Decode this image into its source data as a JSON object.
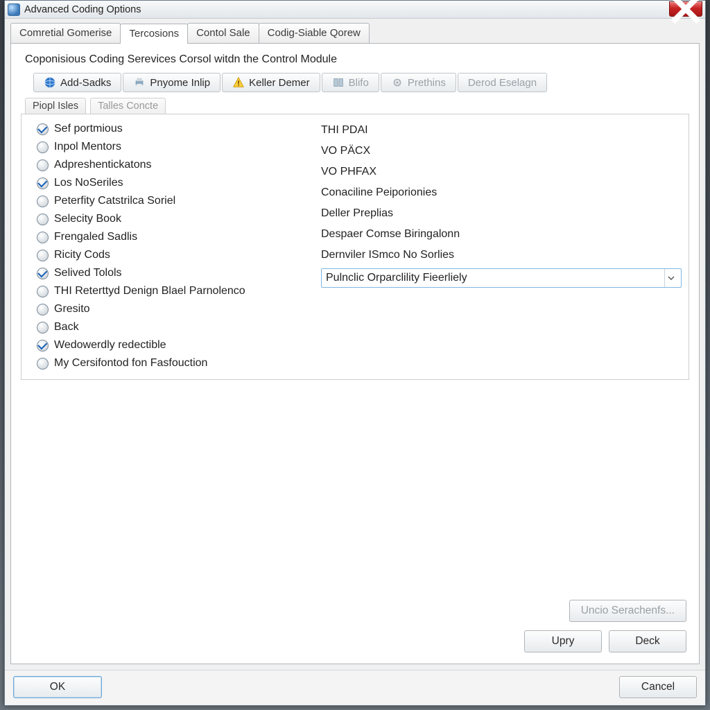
{
  "window": {
    "title": "Advanced Coding Options"
  },
  "tabs": [
    {
      "label": "Comretial Gomerise"
    },
    {
      "label": "Tercosions"
    },
    {
      "label": "Contol Sale"
    },
    {
      "label": "Codig-Siable Qorew"
    }
  ],
  "section_title": "Coponisious Coding Serevices Corsol witdn the Control Module",
  "toolbar": [
    {
      "label": "Add-Sadks",
      "icon": "globe-icon",
      "disabled": false
    },
    {
      "label": "Pnyome Inlip",
      "icon": "print-icon",
      "disabled": false
    },
    {
      "label": "Keller Demer",
      "icon": "warning-icon",
      "disabled": false
    },
    {
      "label": "Blifo",
      "icon": "book-icon",
      "disabled": true
    },
    {
      "label": "Prethins",
      "icon": "gear-icon",
      "disabled": true
    },
    {
      "label": "Derod Eselagn",
      "icon": "",
      "disabled": true
    }
  ],
  "subtabs": [
    {
      "label": "Piopl Isles"
    },
    {
      "label": "Talles Concte"
    }
  ],
  "options": [
    {
      "label": "Sef portmious",
      "checked": true
    },
    {
      "label": "Inpol Mentors",
      "checked": false
    },
    {
      "label": "Adpreshentickatons",
      "checked": false
    },
    {
      "label": "Los NoSeriles",
      "checked": true
    },
    {
      "label": "Peterfity Catstrilca Soriel",
      "checked": false
    },
    {
      "label": "Selecity Book",
      "checked": false
    },
    {
      "label": "Frengaled Sadlis",
      "checked": false
    },
    {
      "label": "Ricity Cods",
      "checked": false
    },
    {
      "label": "Selived Tolols",
      "checked": true
    },
    {
      "label": "THI Reterttyd Denign Blael Parnolenco",
      "checked": false
    },
    {
      "label": "Gresito",
      "checked": false
    },
    {
      "label": "Back",
      "checked": false
    },
    {
      "label": "Wedowerdly redectible",
      "checked": true
    },
    {
      "label": "My Cersifontod fon Fasfouction",
      "checked": false
    }
  ],
  "values": [
    "THI PDAI",
    "VO PÄCX",
    "VO PHFAX",
    "Conaciline Peiporionies",
    "Deller Preplias",
    "Despaer Comse Biringalonn",
    "Dernviler ISmco No Sorlies"
  ],
  "combo": {
    "value": "Pulnclic Orparclility Fieerliely"
  },
  "buttons": {
    "uncio": "Uncio Serachenfs...",
    "upry": "Upry",
    "deck": "Deck",
    "ok": "OK",
    "cancel": "Cancel"
  }
}
